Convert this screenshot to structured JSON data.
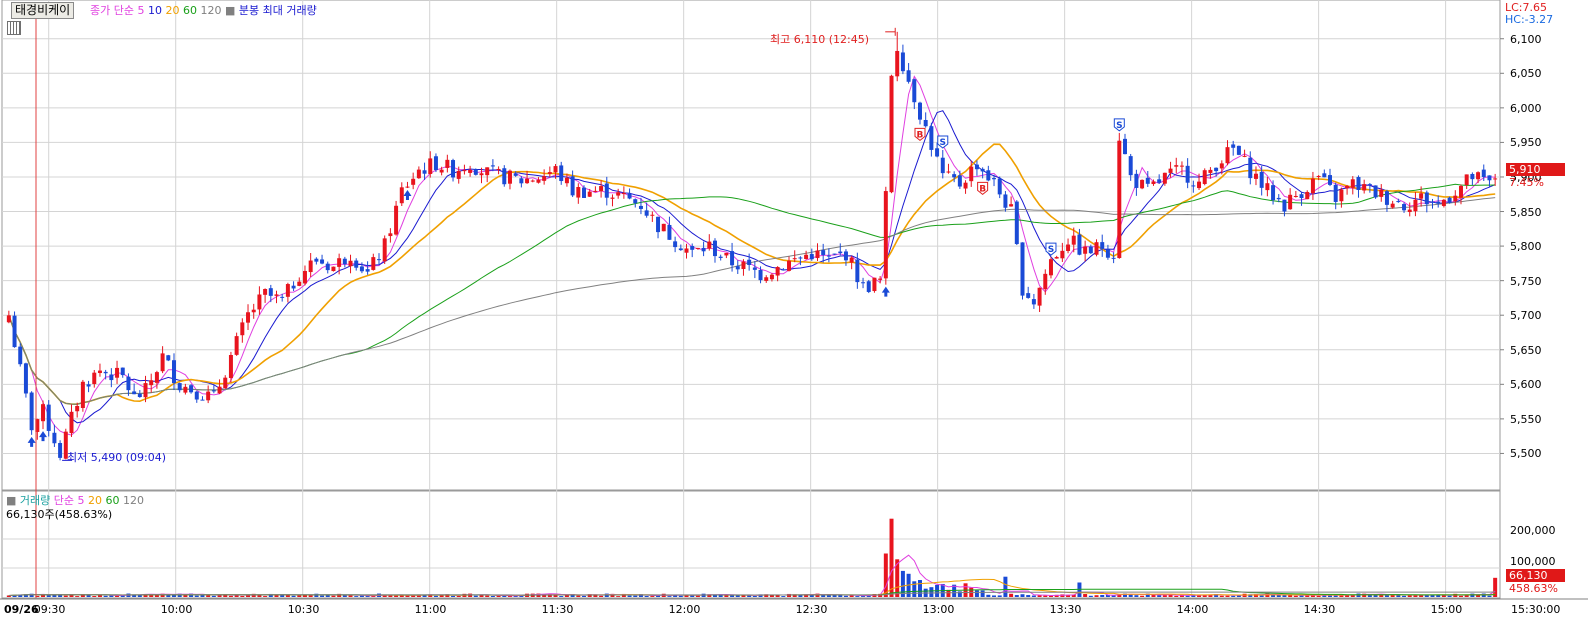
{
  "header": {
    "stock_button": "태경비케이",
    "ma_prefix": "종가 단순",
    "ma_periods": [
      "5",
      "10",
      "20",
      "60",
      "120"
    ],
    "ma_colors": [
      "#e040e0",
      "#1a1ad0",
      "#f0a000",
      "#1aa01a",
      "#808080"
    ],
    "extra_label": "분봉 최대 거래량"
  },
  "right_scale": {
    "lc": "LC:7.65",
    "hc": "HC:-3.27",
    "price_ticks": [
      "6,100",
      "6,050",
      "6,000",
      "5,950",
      "5,900",
      "5,850",
      "5,800",
      "5,750",
      "5,700",
      "5,650",
      "5,600",
      "5,550",
      "5,500"
    ],
    "price_tick_values": [
      6100,
      6050,
      6000,
      5950,
      5900,
      5850,
      5800,
      5750,
      5700,
      5650,
      5600,
      5550,
      5500
    ],
    "current_price": "5,910",
    "current_price_value": 5910,
    "current_change": "7.45%",
    "volume_ticks": [
      "200,000",
      "100,000"
    ],
    "volume_tick_values": [
      200000,
      100000
    ],
    "current_volume": "66,130",
    "current_volume_pct": "458.63%"
  },
  "annotations": {
    "high_label": "최고 6,110 (12:45)",
    "low_label": "최저 5,490 (09:04)"
  },
  "volume_panel": {
    "title": "거래량",
    "ma_prefix": "단순",
    "ma_periods": [
      "5",
      "20",
      "60",
      "120"
    ],
    "ma_colors": [
      "#e040e0",
      "#f0a000",
      "#1aa01a",
      "#808080"
    ],
    "current_text": "66,130주(458.63%)"
  },
  "time_axis": {
    "date": "09/26",
    "ticks": [
      "09:30",
      "10:00",
      "10:30",
      "11:00",
      "11:30",
      "12:00",
      "12:30",
      "13:00",
      "13:30",
      "14:00",
      "14:30",
      "15:00"
    ],
    "end_label": "15:30:00"
  },
  "chart_data": {
    "type": "candlestick",
    "price_range": [
      5450,
      6130
    ],
    "anchor_closes": [
      [
        0,
        5700
      ],
      [
        2,
        5620
      ],
      [
        4,
        5540
      ],
      [
        6,
        5560
      ],
      [
        9,
        5500
      ],
      [
        13,
        5600
      ],
      [
        16,
        5620
      ],
      [
        20,
        5610
      ],
      [
        22,
        5580
      ],
      [
        24,
        5590
      ],
      [
        27,
        5640
      ],
      [
        30,
        5600
      ],
      [
        33,
        5590
      ],
      [
        36,
        5580
      ],
      [
        39,
        5640
      ],
      [
        42,
        5700
      ],
      [
        45,
        5730
      ],
      [
        48,
        5720
      ],
      [
        51,
        5760
      ],
      [
        54,
        5780
      ],
      [
        57,
        5770
      ],
      [
        60,
        5790
      ],
      [
        63,
        5760
      ],
      [
        66,
        5800
      ],
      [
        69,
        5880
      ],
      [
        72,
        5910
      ],
      [
        75,
        5920
      ],
      [
        78,
        5910
      ],
      [
        81,
        5920
      ],
      [
        84,
        5905
      ],
      [
        87,
        5900
      ],
      [
        90,
        5895
      ],
      [
        93,
        5900
      ],
      [
        96,
        5910
      ],
      [
        99,
        5880
      ],
      [
        102,
        5880
      ],
      [
        105,
        5880
      ],
      [
        108,
        5870
      ],
      [
        111,
        5860
      ],
      [
        114,
        5830
      ],
      [
        117,
        5810
      ],
      [
        120,
        5790
      ],
      [
        123,
        5800
      ],
      [
        126,
        5780
      ],
      [
        129,
        5770
      ],
      [
        132,
        5760
      ],
      [
        135,
        5770
      ],
      [
        138,
        5780
      ],
      [
        141,
        5790
      ],
      [
        144,
        5780
      ],
      [
        147,
        5790
      ],
      [
        150,
        5740
      ],
      [
        153,
        5750
      ],
      [
        154,
        5870
      ],
      [
        155,
        6050
      ],
      [
        156,
        6090
      ],
      [
        158,
        6040
      ],
      [
        161,
        5970
      ],
      [
        164,
        5900
      ],
      [
        167,
        5890
      ],
      [
        170,
        5920
      ],
      [
        173,
        5890
      ],
      [
        176,
        5850
      ],
      [
        178,
        5740
      ],
      [
        180,
        5720
      ],
      [
        183,
        5780
      ],
      [
        186,
        5810
      ],
      [
        189,
        5790
      ],
      [
        192,
        5800
      ],
      [
        194,
        5790
      ],
      [
        195,
        5960
      ],
      [
        197,
        5900
      ],
      [
        200,
        5880
      ],
      [
        203,
        5900
      ],
      [
        206,
        5910
      ],
      [
        209,
        5890
      ],
      [
        212,
        5920
      ],
      [
        215,
        5940
      ],
      [
        218,
        5910
      ],
      [
        221,
        5880
      ],
      [
        224,
        5860
      ],
      [
        227,
        5880
      ],
      [
        230,
        5900
      ],
      [
        233,
        5870
      ],
      [
        236,
        5890
      ],
      [
        239,
        5880
      ],
      [
        242,
        5870
      ],
      [
        245,
        5860
      ],
      [
        248,
        5870
      ],
      [
        251,
        5860
      ],
      [
        254,
        5880
      ],
      [
        257,
        5900
      ],
      [
        260,
        5890
      ],
      [
        261,
        5900
      ]
    ],
    "volume_spike_bars": [
      [
        154,
        150000
      ],
      [
        155,
        270000
      ],
      [
        156,
        130000
      ],
      [
        157,
        90000
      ],
      [
        158,
        80000
      ],
      [
        175,
        70000
      ],
      [
        188,
        50000
      ],
      [
        261,
        66130
      ]
    ],
    "high_marker": {
      "price": 6110,
      "time": "12:45"
    },
    "low_marker": {
      "price": 5490,
      "time": "09:04"
    }
  }
}
